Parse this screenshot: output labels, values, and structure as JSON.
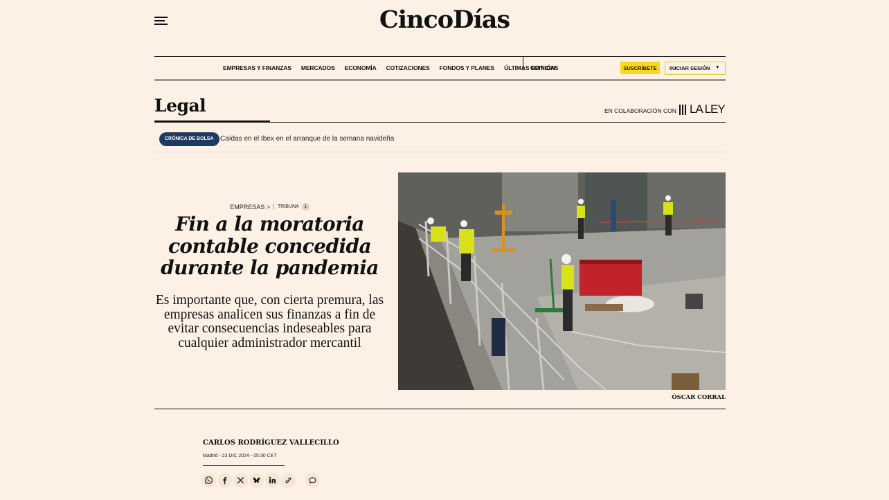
{
  "header": {
    "logo": "CincoDías",
    "menu_icon": "hamburger-menu-icon"
  },
  "nav": {
    "links": [
      "EMPRESAS Y FINANZAS",
      "MERCADOS",
      "ECONOMÍA",
      "COTIZACIONES",
      "FONDOS Y PLANES",
      "ÚLTIMAS NOTICIAS"
    ],
    "opinion": "OPINIÓN",
    "subscribe": "SUSCRÍBETE",
    "login": "INICIAR SESIÓN",
    "login_caret": "▾",
    "accent_color": "#ffd61e"
  },
  "section": {
    "title": "Legal",
    "collab_label": "EN COLABORACIÓN CON",
    "partner": "LA LEY"
  },
  "breaking": {
    "pill": "CRÓNICA DE BOLSA",
    "text": "Caídas en el Ibex en el arranque de la semana navideña",
    "pill_color": "#1e3a63"
  },
  "article": {
    "kicker_section": "EMPRESAS >",
    "kicker_tag": "TRIBUNA",
    "kicker_count": "1",
    "headline": "Fin a la moratoria contable concedida durante la pandemia",
    "subhead": "Es importante que, con cierta premura, las empresas analicen sus finanzas a fin de evitar consecuencias indeseables para cualquier administrador mercantil",
    "photo_credit": "ÓSCAR CORRAL"
  },
  "byline": {
    "author": "CARLOS RODRÍGUEZ VALLECILLO",
    "dateline": "Madrid - 23 DIC 2024 - 05:30 CET"
  },
  "share": {
    "icons": [
      "whatsapp-icon",
      "facebook-icon",
      "x-icon",
      "bluesky-icon",
      "linkedin-icon",
      "link-icon",
      "comment-icon"
    ]
  }
}
